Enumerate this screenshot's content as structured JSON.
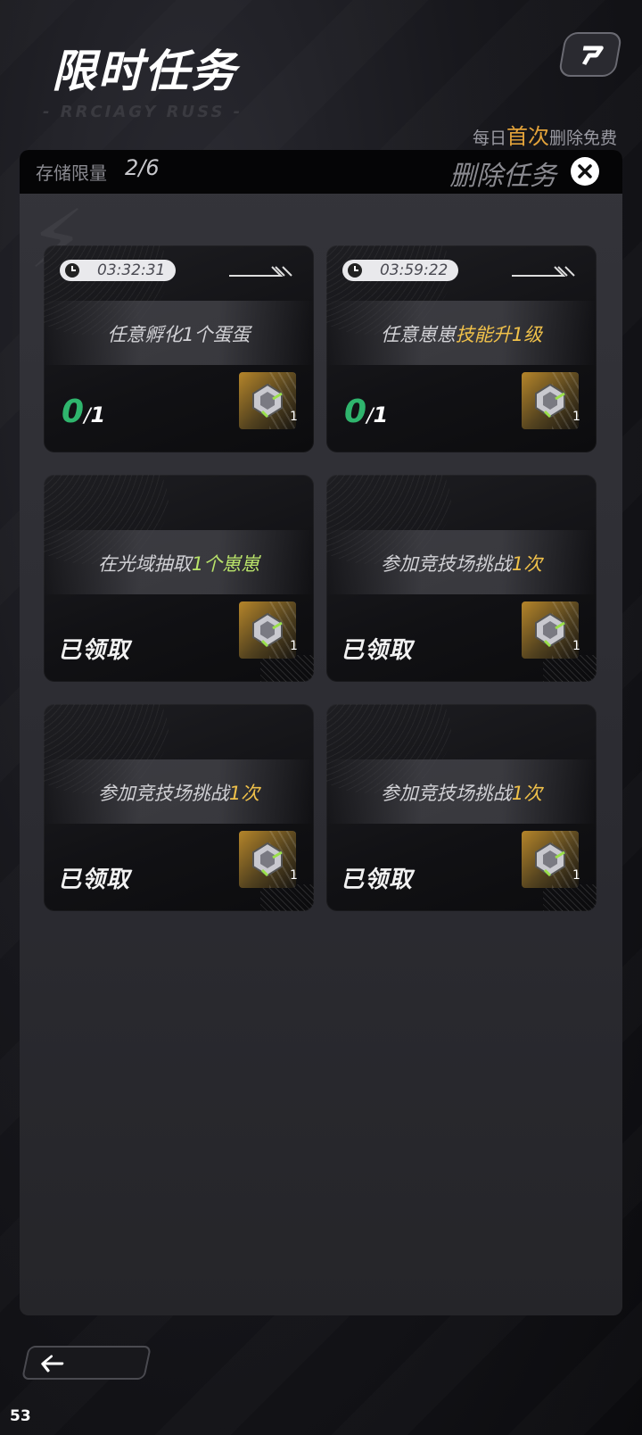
{
  "header": {
    "title": "限时任务",
    "subtitle": "- RRCIAGY RUSS -",
    "free_tip": {
      "prefix": "每日",
      "highlight": "首次",
      "suffix": "删除免费"
    }
  },
  "panel": {
    "limit_label": "存储限量",
    "limit_value": "2/6",
    "delete_label": "删除任务"
  },
  "tasks": [
    {
      "timer": "03:32:31",
      "text_plain": "任意孵化1个蛋蛋",
      "text_hl": "",
      "progress_cur": "0",
      "progress_sep": "/",
      "progress_tot": "1",
      "reward_count": "1"
    },
    {
      "timer": "03:59:22",
      "text_plain": "任意崽崽",
      "text_hl": "技能升1级",
      "progress_cur": "0",
      "progress_sep": "/",
      "progress_tot": "1",
      "reward_count": "1"
    },
    {
      "text_plain": "在光域抽取",
      "text_hl": "1个崽崽",
      "status": "已领取",
      "reward_count": "1"
    },
    {
      "text_plain": "参加竞技场挑战",
      "text_hl": "1次",
      "status": "已领取",
      "reward_count": "1"
    },
    {
      "text_plain": "参加竞技场挑战",
      "text_hl": "1次",
      "status": "已领取",
      "reward_count": "1"
    },
    {
      "text_plain": "参加竞技场挑战",
      "text_hl": "1次",
      "status": "已领取",
      "reward_count": "1"
    }
  ],
  "footer": {
    "level_number": "53"
  },
  "icons": {
    "top_button": "share-icon",
    "close": "close-icon",
    "back": "arrow-left-icon",
    "timer": "clock-icon",
    "reward": "gem-icon"
  },
  "colors": {
    "progress_green": "#2fb56d",
    "highlight_yellow": "#f0c14a",
    "highlight_lime": "#b9e36a",
    "tip_orange": "#e2a23a"
  }
}
